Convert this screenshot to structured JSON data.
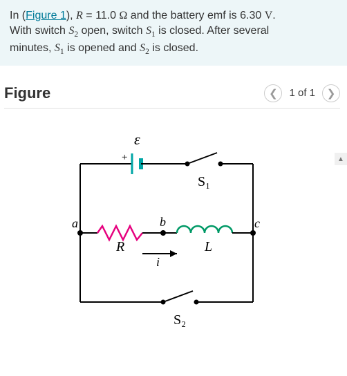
{
  "problem": {
    "pre": "In (",
    "figure_link_text": "Figure 1",
    "post_link": "), ",
    "R_sym": "R",
    "eq": " = 11.0 ",
    "ohm": "Ω",
    "mid": " and the battery emf is 6.30 ",
    "volt": "V",
    "stop": ".",
    "line2_a": "With switch ",
    "S2": "S",
    "S2_sub": "2",
    "line2_b": " open, switch ",
    "S1": "S",
    "S1_sub": "1",
    "line2_c": " is closed. After several",
    "line3_a": "minutes, ",
    "line3_b": " is opened and ",
    "line3_c": " is closed."
  },
  "figure": {
    "heading": "Figure",
    "page_label": "1 of 1",
    "labels": {
      "emf": "ε",
      "plus": "+",
      "S1": "S₁",
      "S2": "S₂",
      "a": "a",
      "b": "b",
      "c": "c",
      "R": "R",
      "L": "L",
      "i": "i"
    }
  },
  "chart_data": {
    "type": "diagram",
    "description": "RL circuit with battery emf ε, resistor R between nodes a and b, inductor L between nodes b and c, switch S1 in the top-right branch, switch S2 in the bottom-right branch, current i flowing left-to-right through R and L.",
    "components": [
      {
        "kind": "battery",
        "label": "ε",
        "value_V": 6.3,
        "between": [
          "top-left-branch"
        ]
      },
      {
        "kind": "switch",
        "label": "S1",
        "state": "open-drawn",
        "location": "top-right-branch"
      },
      {
        "kind": "node",
        "label": "a"
      },
      {
        "kind": "resistor",
        "label": "R",
        "value_ohm": 11.0,
        "between": [
          "a",
          "b"
        ]
      },
      {
        "kind": "node",
        "label": "b"
      },
      {
        "kind": "inductor",
        "label": "L",
        "between": [
          "b",
          "c"
        ]
      },
      {
        "kind": "node",
        "label": "c"
      },
      {
        "kind": "switch",
        "label": "S2",
        "state": "open-drawn",
        "location": "bottom-branch"
      },
      {
        "kind": "current_arrow",
        "label": "i",
        "direction": "right",
        "through": "R-L branch"
      }
    ]
  }
}
